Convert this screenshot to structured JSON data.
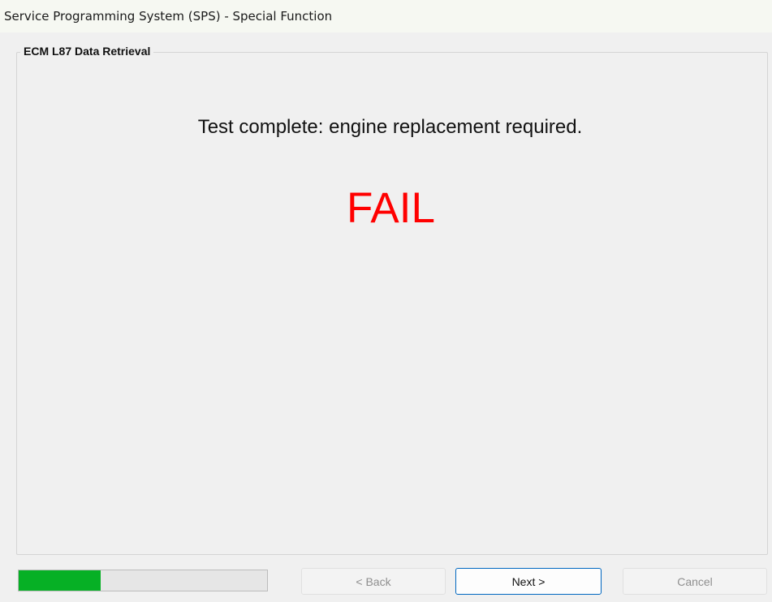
{
  "window": {
    "title": "Service Programming System (SPS) - Special Function"
  },
  "panel": {
    "title": "ECM L87 Data Retrieval",
    "message": "Test complete: engine replacement required.",
    "result": "FAIL",
    "result_color": "#ff0000"
  },
  "progress": {
    "fraction": 0.33,
    "fill_color": "#06b025"
  },
  "buttons": {
    "back": "< Back",
    "next": "Next >",
    "cancel": "Cancel"
  }
}
